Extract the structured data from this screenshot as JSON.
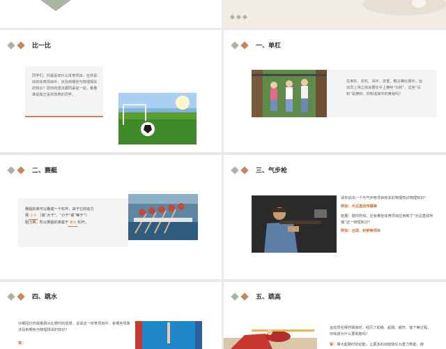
{
  "slides": {
    "s1": {
      "title": "比一比",
      "text": "同学们，你最喜欢什么体育项目，在你喜欢的体育项目中，涉及到哪些与物理相关的知识？把你的想法跟同桌说一说，看看谁是真正喜欢体育的同学。"
    },
    "s2": {
      "title": "一、单杠",
      "text": "在单杠、双杠、吊环、举重、鞍马等比赛中，运动员上场之前会要在手上擦些“白粉”，这些“白粉”是镁粉，你知道其中的奥秘吗？"
    },
    "s3": {
      "title": "二、赛艇",
      "line1": "赛艇的桨可以看成一个杠杆，由于它的动力",
      "line2a": "臂",
      "blank1": "小于",
      "line2b": "（填“大于”、“小于”或“等于”）",
      "line3a": "阻力臂，所以赛艇的桨属于",
      "blank2": "费力",
      "line3b": "杠杆。"
    },
    "s4": {
      "title": "三、气步枪",
      "q1": "请你说出一个与气步枪项目有关的物理知识物理知识？",
      "a1_label": "例如：",
      "a1": "光沿直线传播等",
      "q2": "拓展：据你所知，还有哪些体育项目应用到了“光沿直线传播”这一物理知识？",
      "a2_label": "例如：",
      "a2": "台球、射箭等项目"
    },
    "s5": {
      "title": "四、跳水",
      "text": "仔细回忆你观看跳水比赛时的情景，说说这一体育项目中，有哪些现象涉及到哪些与物理相关的知识？",
      "ans_label": "答："
    },
    "s6": {
      "title": "五、跳高",
      "text": "运动员在撑杆跳高时，经历了助跑、起跳、越杆、落下等过程，你知道为什么要助跑吗？",
      "ans_label": "答：",
      "ans": "撑大起跳时的动能，让更多的动能转化为重力势能，使"
    }
  }
}
